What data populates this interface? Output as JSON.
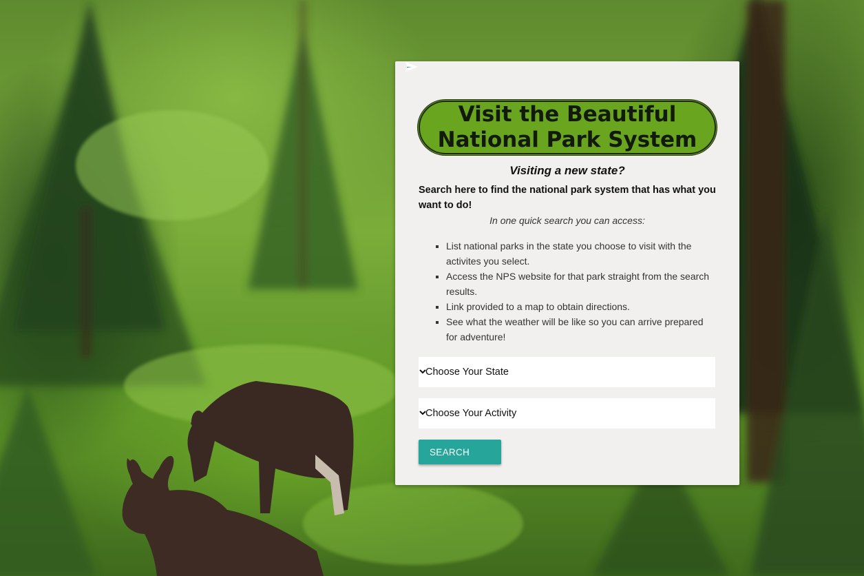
{
  "background": {
    "scene": "moose-in-forest-photo",
    "colors": {
      "grass": "#7bad3a",
      "dark_pine": "#1f3a1a",
      "moose": "#3b2a24"
    }
  },
  "card": {
    "title": "Visit the Beautiful National Park System",
    "subtitle": "Visiting a new state?",
    "lead": "Search here to find the national park system that has what you want to do!",
    "access_text": "In one quick search you can access:",
    "features": [
      "List national parks in the state you choose to visit with the activites you select.",
      "Access the NPS website for that park straight from the search results.",
      "Link provided to a map to obtain directions.",
      "See what the weather will be like so you can arrive prepared for adventure!"
    ],
    "state_select": {
      "selected": "Choose Your State",
      "icon": "chevron-down-icon"
    },
    "activity_select": {
      "selected": "Choose Your Activity",
      "icon": "chevron-down-icon"
    },
    "search_button": {
      "label": "SEARCH",
      "icon": "send-icon"
    },
    "colors": {
      "card_bg": "#f1f0ee",
      "title_pill": "#6aa51f",
      "button": "#26a69a"
    }
  }
}
